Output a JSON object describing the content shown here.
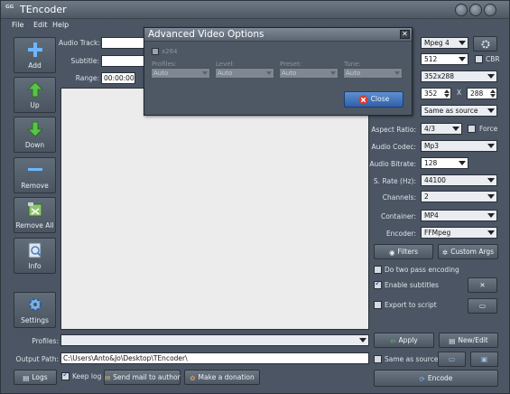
{
  "app": {
    "title": "TEncoder",
    "icon": "tencoder-logo-icon"
  },
  "menu": [
    "File",
    "Edit",
    "Help"
  ],
  "sidebar": [
    {
      "label": "Add",
      "icon": "plus-icon"
    },
    {
      "label": "Up",
      "icon": "arrow-up-icon"
    },
    {
      "label": "Down",
      "icon": "arrow-down-icon"
    },
    {
      "label": "Remove",
      "icon": "minus-icon"
    },
    {
      "label": "Remove All",
      "icon": "remove-all-icon"
    },
    {
      "label": "Info",
      "icon": "info-icon"
    },
    {
      "label": "Settings",
      "icon": "gear-icon"
    }
  ],
  "main": {
    "audio_track_label": "Audio Track:",
    "subtitle_label": "Subtitle:",
    "range_label": "Range:",
    "range_start": "00:00:00"
  },
  "settings": {
    "codec_value": "Mpeg 4",
    "bitrate_value": "512",
    "cbr_label": "CBR",
    "size_value": "352x288",
    "width_value": "352",
    "x_label": "X",
    "height_value": "288",
    "fps_value": "Same as source",
    "aspect_label": "Aspect Ratio:",
    "aspect_value": "4/3",
    "force_label": "Force",
    "audio_codec_label": "Audio Codec:",
    "audio_codec_value": "Mp3",
    "audio_bitrate_label": "Audio Bitrate:",
    "audio_bitrate_value": "128",
    "srate_label": "S. Rate (Hz):",
    "srate_value": "44100",
    "channels_label": "Channels:",
    "channels_value": "2",
    "container_label": "Container:",
    "container_value": "MP4",
    "encoder_label": "Encoder:",
    "encoder_value": "FFMpeg",
    "filters_label": "Filters",
    "custom_args_label": "Custom Args",
    "two_pass_label": "Do two pass encoding",
    "enable_subtitles_label": "Enable subtitles",
    "export_script_label": "Export to script",
    "apply_label": "Apply",
    "new_edit_label": "New/Edit",
    "same_as_source_label": "Same as source",
    "encode_label": "Encode"
  },
  "bottom": {
    "profiles_label": "Profiles:",
    "output_label": "Output Path:",
    "output_value": "C:\\Users\\Anto&Jo\\Desktop\\TEncoder\\",
    "logs_label": "Logs",
    "keep_log_label": "Keep log",
    "send_mail_label": "Send mail to author",
    "donation_label": "Make a donation"
  },
  "dialog": {
    "title": "Advanced Video Options",
    "x264_label": "x264",
    "profiles_label": "Profiles:",
    "level_label": "Level:",
    "preset_label": "Preset:",
    "tune_label": "Tune:",
    "profile_value": "Auto",
    "level_value": "Auto",
    "preset_value": "Auto",
    "tune_value": "Auto",
    "close_label": "Close"
  }
}
